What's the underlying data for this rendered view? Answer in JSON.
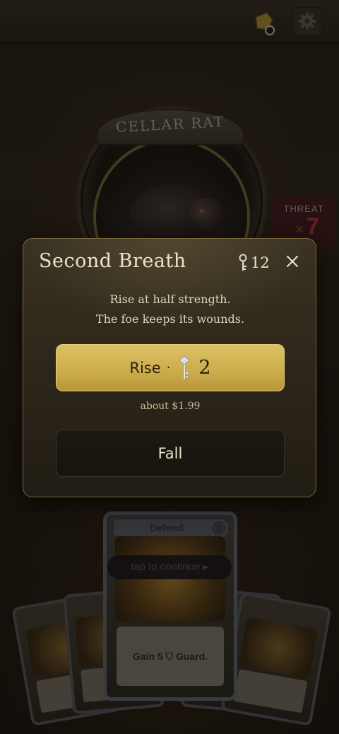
{
  "encounter": {
    "enemy_name": "CELLAR RAT",
    "threat_label": "THREAT",
    "threat_multiplier": "×",
    "threat_value": "7"
  },
  "hud": {
    "relic_icon": "relic-bag-icon",
    "settings_icon": "gear-icon"
  },
  "hand": {
    "focused_card": {
      "title": "Defend",
      "cost": "1",
      "description": "Gain 5 ⛉ Guard."
    },
    "tap_hint": "tap to continue ▸"
  },
  "modal": {
    "title": "Second Breath",
    "balance_icon": "key-icon",
    "balance_value": "12",
    "close_icon": "close-icon",
    "description_lines": [
      "Rise at half strength.",
      "The foe keeps its wounds."
    ],
    "rise_button": {
      "label": "Rise",
      "separator": "·",
      "cost_icon": "key-icon",
      "cost": "2"
    },
    "price_note": "about $1.99",
    "fall_button": {
      "label": "Fall"
    }
  },
  "colors": {
    "modal_border": "#7a6a3c",
    "rise_button": "#cdae4c",
    "threat_accent": "#c4363c"
  }
}
